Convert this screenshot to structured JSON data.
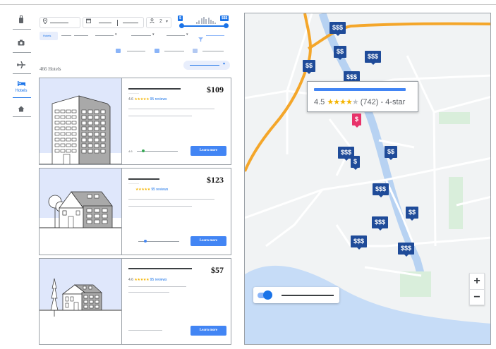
{
  "nav": {
    "items": [
      {
        "icon": "luggage-icon",
        "glyph": "⬮"
      },
      {
        "icon": "camera-icon",
        "glyph": "◘"
      },
      {
        "icon": "flight-icon",
        "glyph": "✈"
      },
      {
        "icon": "hotel-bed-icon",
        "glyph": "🛏",
        "label": "Hotels",
        "active": true
      },
      {
        "icon": "home-icon",
        "glyph": "⌂"
      }
    ]
  },
  "search": {
    "guests": "2",
    "guests_caret": "▾"
  },
  "price_filter": {
    "min_label": "$",
    "max_label": "$$$",
    "range_fraction": [
      0.0,
      1.0
    ]
  },
  "filters": {
    "first_chip": "Hotels"
  },
  "results": {
    "count": "466 Hotels",
    "sort_caret": "▾"
  },
  "hotels": [
    {
      "rating": "4.6",
      "stars": "★★★★★",
      "reviews": "95 reviews",
      "price": "$109",
      "button": "Learn more",
      "toggle_label": "4.6"
    },
    {
      "rating": "",
      "stars": "★★★★★",
      "reviews": "95 reviews",
      "price": "$123",
      "button": "Learn more"
    },
    {
      "rating": "4.6",
      "stars": "★★★★★",
      "reviews": "95 reviews",
      "price": "$57",
      "button": "Learn more"
    }
  ],
  "map": {
    "pins": [
      "$$$",
      "$$",
      "$$$",
      "$$",
      "$$$",
      "$",
      "$$$",
      "$",
      "$$",
      "$$$",
      "$$",
      "$$$",
      "$$$",
      "$$$"
    ],
    "tooltip": {
      "rating": "4.5",
      "stars_on": "★★★★",
      "stars_off": "★",
      "reviews": "(742)",
      "class": "- 4-star"
    },
    "zoom_in": "+",
    "zoom_out": "−"
  },
  "colors": {
    "accent": "#1a73e8",
    "pin": "#1f4b99",
    "pin_selected": "#e8326a",
    "star": "#f4b400",
    "road_major": "#f4a62a"
  }
}
